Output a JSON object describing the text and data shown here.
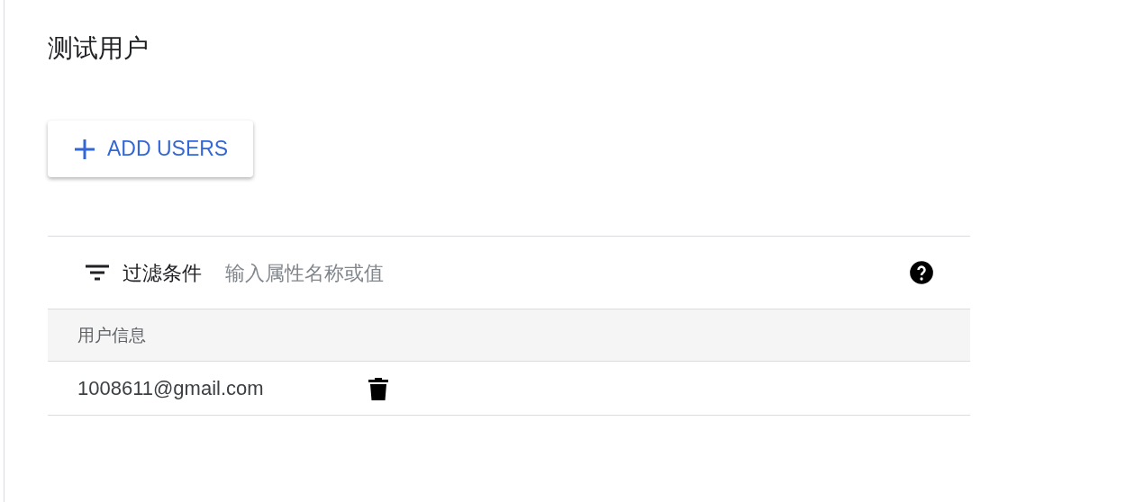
{
  "title": "测试用户",
  "add_button": {
    "label": "ADD USERS"
  },
  "filter": {
    "label": "过滤条件",
    "placeholder": "输入属性名称或值"
  },
  "table": {
    "columns": [
      "用户信息"
    ],
    "rows": [
      {
        "email": "1008611@gmail.com"
      }
    ]
  }
}
